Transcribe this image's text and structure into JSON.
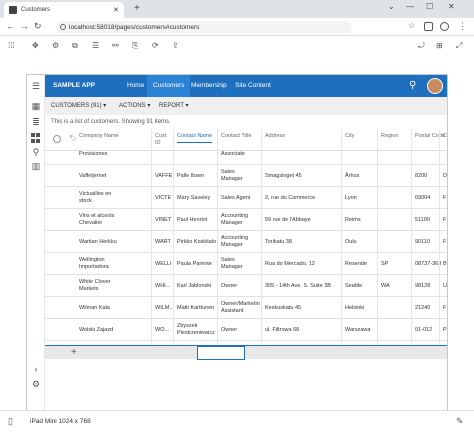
{
  "browser": {
    "tab_title": "Customers",
    "url": "localhost:58018/pages/customers#customers"
  },
  "app": {
    "brand": "SAMPLE APP",
    "menu": [
      "Home",
      "Customers",
      "Membership",
      "Site Content"
    ],
    "active_menu": "Customers"
  },
  "actionbar": {
    "customers": "CUSTOMERS (91) ▾",
    "actions": "ACTIONS ▾",
    "report": "REPORT ▾"
  },
  "subtitle": "This is a list of customers. Showing 91 items.",
  "table": {
    "columns": [
      "Company Name",
      "Cust\nID",
      "Contact Name",
      "Contact Title",
      "Address",
      "City",
      "Region",
      "Postal Code",
      "C"
    ],
    "active_column": "Contact Name",
    "rows": [
      [
        "Provisiones",
        "",
        "",
        "Associate",
        "",
        "",
        "",
        "",
        ""
      ],
      [
        "Vaffeljernet",
        "VAFFE",
        "Palle Ibsen",
        "Sales\nManager",
        "Smagsloget 45",
        "Århus",
        "",
        "8200",
        "D"
      ],
      [
        "Victuailles en\nstock",
        "VICTE",
        "Mary Saveley",
        "Sales Agent",
        "2, rue du Commerce",
        "Lyon",
        "",
        "69004",
        "F"
      ],
      [
        "Vins et alcools\nChevalier",
        "VINET",
        "Paul Henriot",
        "Accounting\nManager",
        "59 rue de l'Abbaye",
        "Reims",
        "",
        "51100",
        "F"
      ],
      [
        "Wartian Herkku",
        "WART",
        "Pirkko Koskitalo",
        "Accounting\nManager",
        "Torikatu 38",
        "Oulu",
        "",
        "90110",
        "F"
      ],
      [
        "Wellington\nImportadora",
        "WELLI",
        "Paula Parente",
        "Sales\nManager",
        "Rua do Mercado, 12",
        "Resende",
        "SP",
        "08737-363",
        "B"
      ],
      [
        "White Clover\nMarkets",
        "WHI...",
        "Karl Jablonski",
        "Owner",
        "305 - 14th Ave. S. Suite 3B",
        "Seattle",
        "WA",
        "98128",
        "U"
      ],
      [
        "Wilman Kala",
        "WILM...",
        "Matti Karttunen",
        "Owner/Marketin\nAssistant",
        "Keskuskatu 45",
        "Helsinki",
        "",
        "21240",
        "F"
      ],
      [
        "Wolski Zajazd",
        "WO...",
        "Zbyszek\nPiestrzeniewicz",
        "Owner",
        "ul. Filtrowa 68",
        "Warszawa",
        "",
        "01-012",
        "P"
      ]
    ]
  },
  "footer": {
    "device": "iPad Mini 1024 x 768"
  }
}
